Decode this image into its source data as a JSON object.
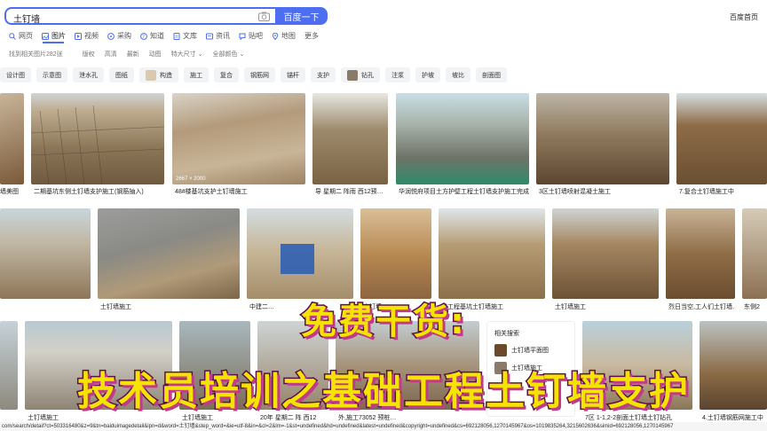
{
  "search": {
    "query": "土钉墙",
    "button": "百度一下"
  },
  "header": {
    "home_link": "百度首页"
  },
  "nav": [
    {
      "label": "网页",
      "icon": "search-icon"
    },
    {
      "label": "图片",
      "icon": "image-icon",
      "active": true
    },
    {
      "label": "视频",
      "icon": "video-icon"
    },
    {
      "label": "采购",
      "icon": "cart-icon"
    },
    {
      "label": "知道",
      "icon": "question-icon"
    },
    {
      "label": "文库",
      "icon": "doc-icon"
    },
    {
      "label": "资讯",
      "icon": "news-icon"
    },
    {
      "label": "贴吧",
      "icon": "tieba-icon"
    },
    {
      "label": "地图",
      "icon": "map-icon"
    },
    {
      "label": "更多",
      "icon": ""
    }
  ],
  "filters": {
    "result_count": "找到相关图片282张",
    "items": [
      "版权",
      "高清",
      "最新",
      "动图",
      "特大尺寸 ⌄",
      "全部颜色 ⌄"
    ]
  },
  "chips": [
    "设计图",
    "示意图",
    "泄水孔",
    "图纸",
    "构造",
    "施工",
    "复合",
    "钢筋网",
    "锚杆",
    "支护",
    "钻孔",
    "注浆",
    "护坡",
    "坡比",
    "剖面图"
  ],
  "row1": [
    {
      "caption": "墙美图",
      "size": ""
    },
    {
      "caption": "二期基坑东侧土钉墙支护施工(钢筋抽入)",
      "size": ""
    },
    {
      "caption": "48#楼基坑支护土钉墙施工",
      "size": "2667 × 2000"
    },
    {
      "caption": "导 星期二 阵雨 西12预…",
      "size": ""
    },
    {
      "caption": "华润悦府项目土方护壁工程土钉墙支护施工完成",
      "size": ""
    },
    {
      "caption": "3区土钉墙喷射混凝土施工",
      "size": ""
    },
    {
      "caption": "7.复合土钉墙施工中",
      "size": ""
    }
  ],
  "row2": [
    {
      "caption": "",
      "size": ""
    },
    {
      "caption": "土钉墙施工",
      "size": ""
    },
    {
      "caption": "中建二…",
      "size": ""
    },
    {
      "caption": "土钉墙",
      "size": ""
    },
    {
      "caption": "某工程基坑土钉墙施工",
      "size": ""
    },
    {
      "caption": "土钉墙施工",
      "size": ""
    },
    {
      "caption": "烈日当空,工人们土钉墙…",
      "size": ""
    },
    {
      "caption": "东侧2",
      "size": ""
    }
  ],
  "row3": [
    {
      "caption": "土钉墙施工",
      "size": ""
    },
    {
      "caption": "土钉墙施工",
      "size": ""
    },
    {
      "caption": "20年 星期二 阵 西12",
      "size": ""
    },
    {
      "caption": "外,施工73052 预桩…",
      "size": ""
    },
    {
      "caption": "7区 1-1,2-2剖面土钉墙土钉钻孔",
      "size": ""
    },
    {
      "caption": "4.土钉墙钢筋网施工中",
      "size": ""
    }
  ],
  "related": {
    "title": "相关搜索",
    "items": [
      "土钉墙平面图",
      "土钉墙施工"
    ]
  },
  "status_url": "com/search/detail?ct=503316480&z=9&tn=baiduimagedetail&ipn=d&word=土钉墙&step_word=&ie=utf-8&in=&cl=2&lm=-1&st=undefined&hd=undefined&latest=undefined&copyright=undefined&cs=692128056,1270145967&os=1019835264,3215602636&simid=692128056,1270145967",
  "overlay": {
    "line1": "免费干货:",
    "line2": "技术员培训之基础工程土钉墙支护"
  },
  "colors": {
    "accent": "#4e6ef2",
    "overlay_fill": "#f4e400",
    "overlay_stroke": "#5a0f4a"
  }
}
